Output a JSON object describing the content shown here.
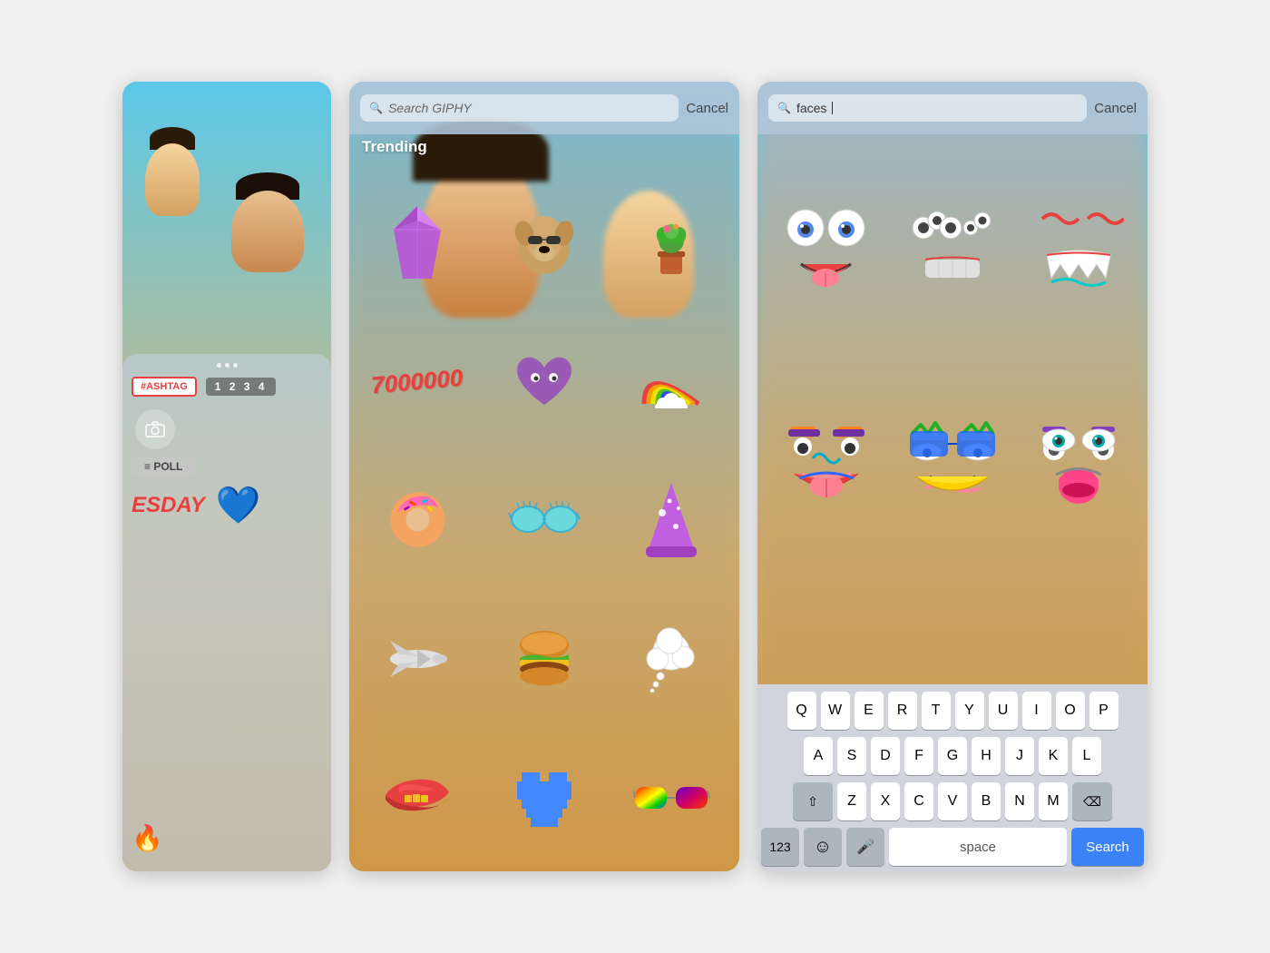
{
  "screens": {
    "screen1": {
      "stickers": {
        "hashtag": "#ASHTAG",
        "counter": "1 2 3 4",
        "poll": "≡ POLL",
        "tuesday": "ESDAY",
        "heart": "💙",
        "flame": "🔥"
      }
    },
    "screen2": {
      "search_placeholder": "Search GIPHY",
      "cancel_label": "Cancel",
      "trending_label": "Trending",
      "stickers": [
        {
          "id": "crystal",
          "emoji": "💎"
        },
        {
          "id": "dog",
          "emoji": "🐶"
        },
        {
          "id": "food",
          "emoji": "🌵"
        },
        {
          "id": "seven_mil",
          "text": "7000000"
        },
        {
          "id": "purple_heart",
          "emoji": "💜"
        },
        {
          "id": "rainbow",
          "emoji": "🌈"
        },
        {
          "id": "donut",
          "emoji": "🍩"
        },
        {
          "id": "sunglasses",
          "emoji": "🕶"
        },
        {
          "id": "wizard_hat",
          "emoji": "🎩"
        },
        {
          "id": "plane",
          "emoji": "🚀"
        },
        {
          "id": "burger",
          "emoji": "🍔"
        },
        {
          "id": "cloud",
          "emoji": "💭"
        },
        {
          "id": "lips",
          "emoji": "👄"
        },
        {
          "id": "pixel_heart",
          "emoji": "💙"
        },
        {
          "id": "rainbow_glasses",
          "emoji": "🕶"
        }
      ]
    },
    "screen3": {
      "search_value": "faces",
      "cancel_label": "Cancel",
      "keyboard": {
        "row1": [
          "Q",
          "W",
          "E",
          "R",
          "T",
          "Y",
          "U",
          "I",
          "O",
          "P"
        ],
        "row2": [
          "A",
          "S",
          "D",
          "F",
          "G",
          "H",
          "J",
          "K",
          "L"
        ],
        "row3": [
          "Z",
          "X",
          "C",
          "V",
          "B",
          "N",
          "M"
        ],
        "num_label": "123",
        "emoji_label": "☺",
        "mic_label": "🎤",
        "space_label": "space",
        "search_label": "Search",
        "delete_label": "⌫",
        "shift_label": "⇧"
      }
    }
  }
}
